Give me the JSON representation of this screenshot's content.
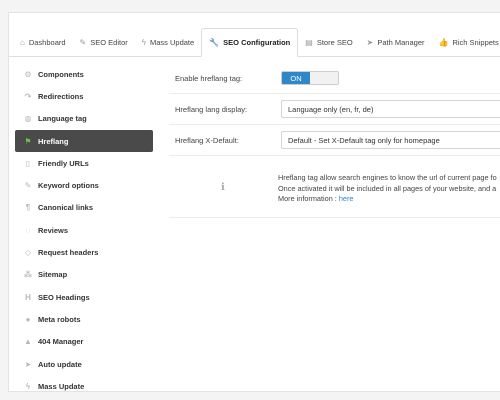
{
  "tabs": [
    {
      "label": "Dashboard",
      "icon": "home-icon",
      "glyph": "⌂"
    },
    {
      "label": "SEO Editor",
      "icon": "edit-icon",
      "glyph": "✎"
    },
    {
      "label": "Mass Update",
      "icon": "bolt-icon",
      "glyph": "ϟ"
    },
    {
      "label": "SEO Configuration",
      "icon": "wrench-icon",
      "glyph": "🔧",
      "active": true
    },
    {
      "label": "Store SEO",
      "icon": "store-icon",
      "glyph": "▤"
    },
    {
      "label": "Path Manager",
      "icon": "send-icon",
      "glyph": "➤"
    },
    {
      "label": "Rich Snippets",
      "icon": "thumbs-up-icon",
      "glyph": "👍"
    }
  ],
  "sidebar": [
    {
      "label": "Components",
      "icon": "gear-icon",
      "glyph": "⚙"
    },
    {
      "label": "Redirections",
      "icon": "redirect-icon",
      "glyph": "↷"
    },
    {
      "label": "Language tag",
      "icon": "globe-icon",
      "glyph": "◍"
    },
    {
      "label": "Hreflang",
      "icon": "flag-icon",
      "glyph": "⚑",
      "active": true
    },
    {
      "label": "Friendly URLs",
      "icon": "file-icon",
      "glyph": "▯"
    },
    {
      "label": "Keyword options",
      "icon": "edit-icon",
      "glyph": "✎"
    },
    {
      "label": "Canonical links",
      "icon": "paragraph-icon",
      "glyph": "¶"
    },
    {
      "label": "Reviews",
      "icon": "comment-icon",
      "glyph": "◌"
    },
    {
      "label": "Request headers",
      "icon": "diamond-icon",
      "glyph": "◇"
    },
    {
      "label": "Sitemap",
      "icon": "sitemap-icon",
      "glyph": "⁂"
    },
    {
      "label": "SEO Headings",
      "icon": "heading-icon",
      "glyph": "H"
    },
    {
      "label": "Meta robots",
      "icon": "robot-icon",
      "glyph": "●"
    },
    {
      "label": "404 Manager",
      "icon": "warning-icon",
      "glyph": "▲"
    },
    {
      "label": "Auto update",
      "icon": "send-icon",
      "glyph": "➤"
    },
    {
      "label": "Mass Update",
      "icon": "bolt-icon",
      "glyph": "ϟ"
    }
  ],
  "form": {
    "enable_label": "Enable hreflang tag:",
    "enable_state": "ON",
    "display_label": "Hreflang lang display:",
    "display_value": "Language only (en, fr, de)",
    "default_label": "Hreflang X-Default:",
    "default_value": "Default - Set X-Default tag only for homepage"
  },
  "info": {
    "line1": "Hreflang tag allow search engines to know the url of current page fo",
    "line2": "Once activated it will be included in all pages of your website, and a",
    "line3_prefix": "More information : ",
    "link": "here",
    "icon_glyph": "ℹ"
  }
}
